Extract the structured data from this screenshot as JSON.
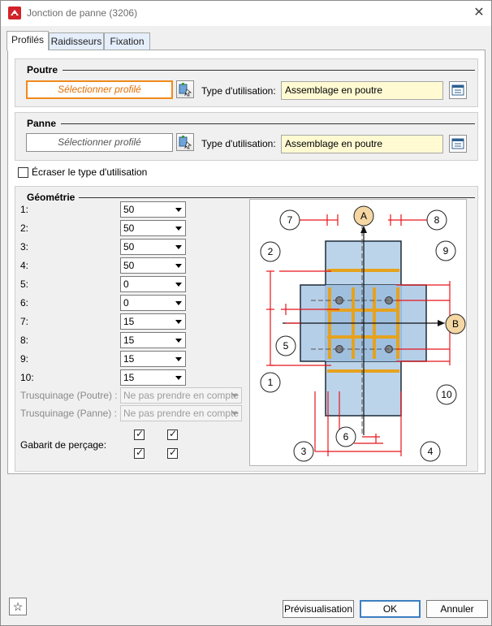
{
  "window": {
    "title": "Jonction de panne (3206)",
    "close_glyph": "✕"
  },
  "tabs": [
    {
      "label": "Profilés",
      "active": true
    },
    {
      "label": "Raidisseurs",
      "active": false
    },
    {
      "label": "Fixation",
      "active": false
    }
  ],
  "poutre": {
    "group_title": "Poutre",
    "select_label": "Sélectionner profilé",
    "usage_label": "Type d'utilisation:",
    "usage_value": "Assemblage en poutre"
  },
  "panne": {
    "group_title": "Panne",
    "select_label": "Sélectionner profilé",
    "usage_label": "Type d'utilisation:",
    "usage_value": "Assemblage en poutre"
  },
  "overwrite": {
    "label": "Écraser le type d'utilisation",
    "checked": false
  },
  "geometrie": {
    "group_title": "Géométrie",
    "rows": [
      {
        "label": "1:",
        "value": "50"
      },
      {
        "label": "2:",
        "value": "50"
      },
      {
        "label": "3:",
        "value": "50"
      },
      {
        "label": "4:",
        "value": "50"
      },
      {
        "label": "5:",
        "value": "0"
      },
      {
        "label": "6:",
        "value": "0"
      },
      {
        "label": "7:",
        "value": "15"
      },
      {
        "label": "8:",
        "value": "15"
      },
      {
        "label": "9:",
        "value": "15"
      },
      {
        "label": "10:",
        "value": "15"
      }
    ],
    "trusquinage_poutre": {
      "label": "Trusquinage (Poutre) :",
      "value": "Ne pas prendre en compte"
    },
    "trusquinage_panne": {
      "label": "Trusquinage (Panne) :",
      "value": "Ne pas prendre en compte"
    },
    "gabarit": {
      "label": "Gabarit de perçage:",
      "checks": [
        true,
        true,
        true,
        true
      ]
    }
  },
  "diagram": {
    "axis_a": "A",
    "axis_b": "B",
    "callouts": [
      "1",
      "2",
      "3",
      "4",
      "5",
      "6",
      "7",
      "8",
      "9",
      "10"
    ],
    "colors": {
      "red": "#e8141c",
      "steel": "#bcd4ea",
      "steel_dark": "#9fbfdf",
      "plate": "#a9c7e4",
      "bolt": "#e6a21e",
      "badge": "#f5d7a4"
    }
  },
  "footer": {
    "favorite_glyph": "☆",
    "preview_label": "Prévisualisation",
    "ok_label": "OK",
    "cancel_label": "Annuler"
  }
}
